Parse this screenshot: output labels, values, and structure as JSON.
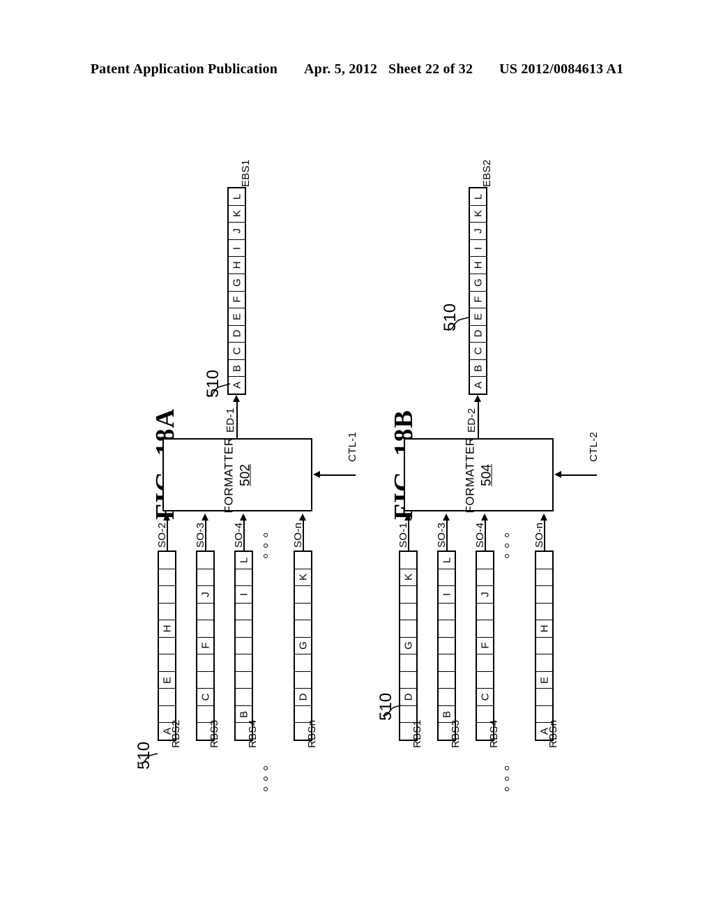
{
  "header": {
    "publication": "Patent Application Publication",
    "date": "Apr. 5, 2012",
    "sheet": "Sheet 22 of 32",
    "docnum": "US 2012/0084613 A1"
  },
  "figures": [
    {
      "id": "fig-18a",
      "title": "FIG. 18A",
      "formatter": {
        "name": "FORMATTER",
        "number": "502"
      },
      "control_signal": "CTL-1",
      "output_signal": "ED-1",
      "output_buffer": {
        "name": "EBS1",
        "ref": "510",
        "cells": [
          "A",
          "B",
          "C",
          "D",
          "E",
          "F",
          "G",
          "H",
          "I",
          "J",
          "K",
          "L"
        ]
      },
      "input_ref": "510",
      "ellipsis_label": "○ ○ ○",
      "inputs": [
        {
          "buffer_name": "RBS2",
          "signal": "SO-2",
          "cells": [
            "A",
            "",
            "",
            "E",
            "",
            "",
            "H",
            "",
            "",
            "",
            ""
          ]
        },
        {
          "buffer_name": "RBS3",
          "signal": "SO-3",
          "cells": [
            "",
            "",
            "C",
            "",
            "",
            "F",
            "",
            "",
            "J",
            "",
            ""
          ]
        },
        {
          "buffer_name": "RBS4",
          "signal": "SO-4",
          "cells": [
            "",
            "B",
            "",
            "",
            "",
            "",
            "",
            "",
            "I",
            "",
            "L"
          ]
        },
        {
          "buffer_name": "RBSn",
          "signal": "SO-n",
          "cells": [
            "",
            "",
            "D",
            "",
            "",
            "G",
            "",
            "",
            "",
            "K",
            ""
          ]
        }
      ]
    },
    {
      "id": "fig-18b",
      "title": "FIG. 18B",
      "formatter": {
        "name": "FORMATTER",
        "number": "504"
      },
      "control_signal": "CTL-2",
      "output_signal": "ED-2",
      "output_buffer": {
        "name": "EBS2",
        "ref": "510",
        "cells": [
          "A",
          "B",
          "C",
          "D",
          "E",
          "F",
          "G",
          "H",
          "I",
          "J",
          "K",
          "L"
        ]
      },
      "input_ref": "510",
      "ellipsis_label": "○ ○ ○",
      "inputs": [
        {
          "buffer_name": "RBS1",
          "signal": "SO-1",
          "cells": [
            "",
            "",
            "D",
            "",
            "",
            "G",
            "",
            "",
            "",
            "K",
            ""
          ]
        },
        {
          "buffer_name": "RBS3",
          "signal": "SO-3",
          "cells": [
            "",
            "B",
            "",
            "",
            "",
            "",
            "",
            "",
            "I",
            "",
            "L"
          ]
        },
        {
          "buffer_name": "RBS4",
          "signal": "SO-4",
          "cells": [
            "",
            "",
            "C",
            "",
            "",
            "F",
            "",
            "",
            "J",
            "",
            ""
          ]
        },
        {
          "buffer_name": "RBSn",
          "signal": "SO-n",
          "cells": [
            "A",
            "",
            "",
            "E",
            "",
            "",
            "H",
            "",
            "",
            "",
            ""
          ]
        }
      ]
    }
  ]
}
